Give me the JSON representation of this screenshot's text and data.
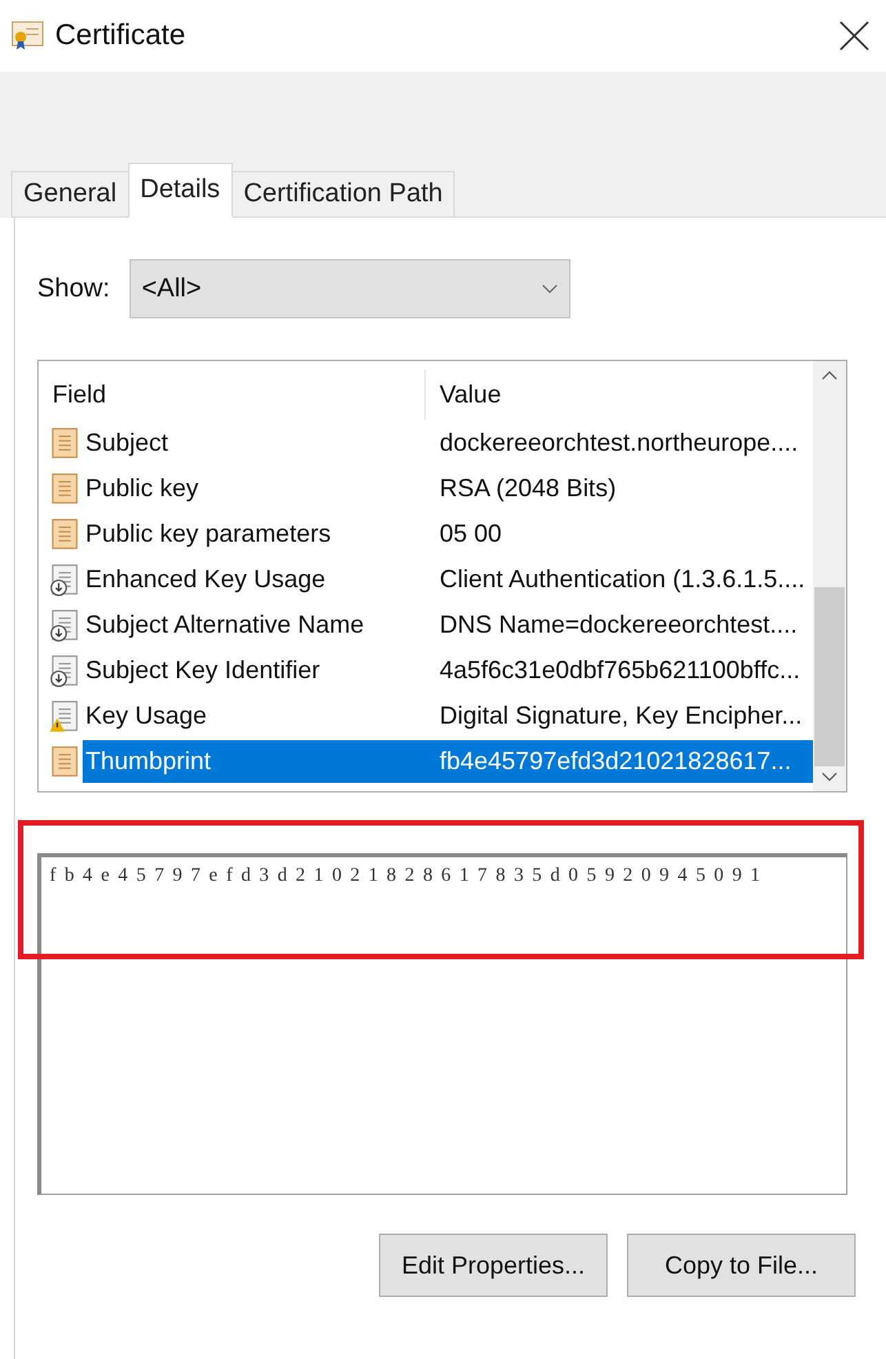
{
  "window": {
    "title": "Certificate"
  },
  "tabs": [
    {
      "label": "General",
      "selected": false
    },
    {
      "label": "Details",
      "selected": true
    },
    {
      "label": "Certification Path",
      "selected": false
    }
  ],
  "show": {
    "label": "Show:",
    "value": "<All>"
  },
  "table": {
    "columns": [
      "Field",
      "Value"
    ],
    "rows": [
      {
        "kind": "plain",
        "field": "Subject",
        "value": "dockereeorchtest.northeurope....",
        "selected": false
      },
      {
        "kind": "plain",
        "field": "Public key",
        "value": "RSA (2048 Bits)",
        "selected": false
      },
      {
        "kind": "plain",
        "field": "Public key parameters",
        "value": "05 00",
        "selected": false
      },
      {
        "kind": "extension",
        "field": "Enhanced Key Usage",
        "value": "Client Authentication (1.3.6.1.5....",
        "selected": false
      },
      {
        "kind": "extension",
        "field": "Subject Alternative Name",
        "value": "DNS Name=dockereeorchtest....",
        "selected": false
      },
      {
        "kind": "extension",
        "field": "Subject Key Identifier",
        "value": "4a5f6c31e0dbf765b621100bffc...",
        "selected": false
      },
      {
        "kind": "critical",
        "field": "Key Usage",
        "value": "Digital Signature, Key Encipher...",
        "selected": false
      },
      {
        "kind": "plain",
        "field": "Thumbprint",
        "value": "fb4e45797efd3d21021828617...",
        "selected": true
      }
    ]
  },
  "detail": {
    "value": "fb4e45797efd3d21021828617835d05920945091",
    "highlighted": true
  },
  "buttons": [
    "Edit Properties...",
    "Copy to File..."
  ]
}
